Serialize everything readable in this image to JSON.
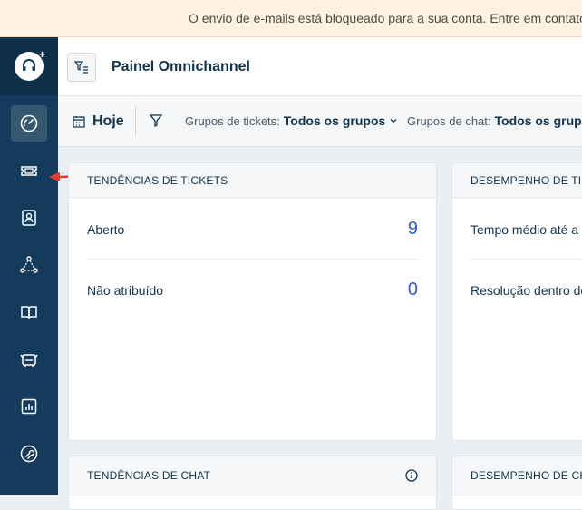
{
  "banner": {
    "text": "O envio de e-mails está bloqueado para a sua conta. Entre em contato"
  },
  "sidebar": {
    "logo": "headset-logo",
    "items": [
      {
        "icon": "dashboard-icon",
        "active": true
      },
      {
        "icon": "ticket-icon",
        "active": false
      },
      {
        "icon": "contact-icon",
        "active": false
      },
      {
        "icon": "network-icon",
        "active": false
      },
      {
        "icon": "book-icon",
        "active": false
      },
      {
        "icon": "freddy-icon",
        "active": false
      },
      {
        "icon": "reports-icon",
        "active": false
      },
      {
        "icon": "wrench-icon",
        "active": false
      }
    ]
  },
  "header": {
    "title": "Painel Omnichannel"
  },
  "filters": {
    "date_range": "Hoje",
    "ticket_groups_label": "Grupos de tickets:",
    "ticket_groups_value": "Todos os grupos",
    "chat_groups_label": "Grupos de chat:",
    "chat_groups_value": "Todos os grupos"
  },
  "cards": {
    "ticket_trends": {
      "title": "TENDÊNCIAS DE TICKETS",
      "rows": [
        {
          "label": "Aberto",
          "value": "9"
        },
        {
          "label": "Não atribuído",
          "value": "0"
        }
      ]
    },
    "ticket_performance": {
      "title": "DESEMPENHO DE TICKETS",
      "rows": [
        {
          "label": "Tempo médio até a primeira resposta"
        },
        {
          "label": "Resolução dentro do SLA"
        }
      ]
    },
    "chat_trends": {
      "title": "TENDÊNCIAS DE CHAT"
    },
    "chat_performance": {
      "title": "DESEMPENHO DE CHAT"
    }
  },
  "colors": {
    "accent": "#2c5cc5",
    "sidebar": "#143b5c",
    "arrow": "#e53935"
  }
}
